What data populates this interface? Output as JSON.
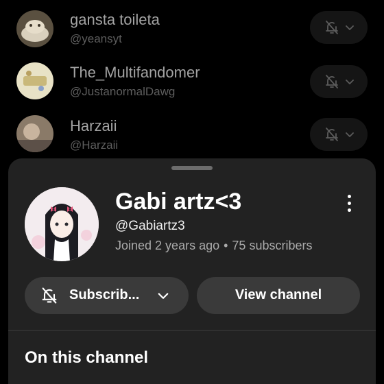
{
  "subscriptions": [
    {
      "name": "gansta toileta",
      "handle": "@yeansyt",
      "icon": "bell-off-icon"
    },
    {
      "name": "The_Multifandomer",
      "handle": "@JustanormalDawg",
      "icon": "bell-off-icon"
    },
    {
      "name": "Harzaii",
      "handle": "@Harzaii",
      "icon": "bell-off-icon"
    }
  ],
  "channel_sheet": {
    "name": "Gabi artz<3",
    "handle": "@Gabiartz3",
    "joined": "Joined 2 years ago",
    "separator": "•",
    "subscribers": "75 subscribers",
    "subscribe_label": "Subscrib...",
    "view_label": "View channel",
    "section_title": "On this channel"
  },
  "colors": {
    "background": "#000000",
    "sheet": "#222222",
    "button": "#3a3a3a",
    "secondary_text": "#aaaaaa"
  }
}
